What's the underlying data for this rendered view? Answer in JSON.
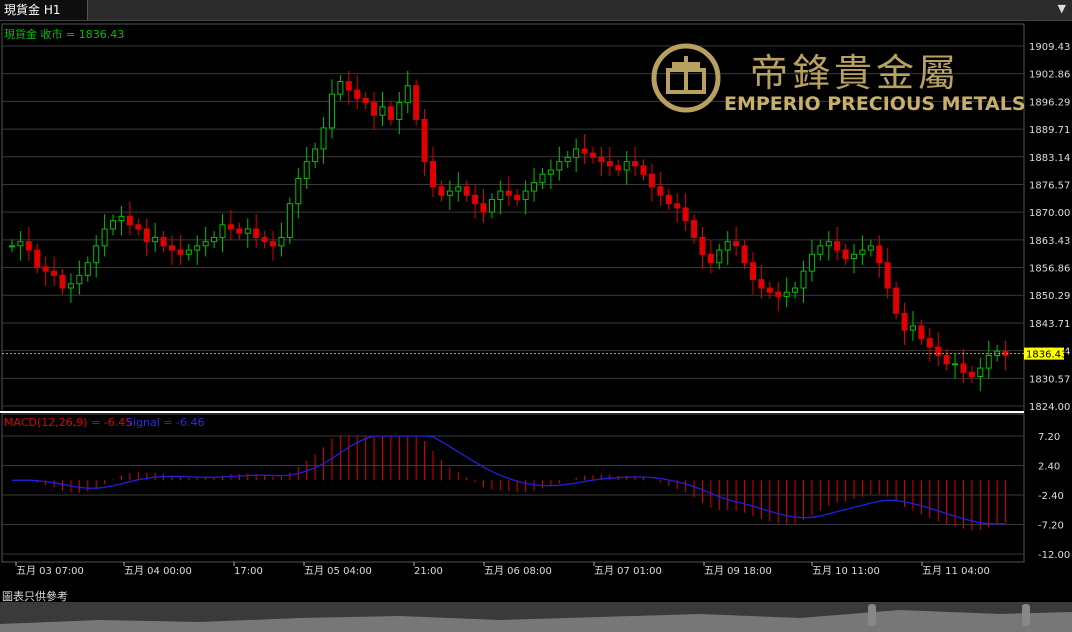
{
  "window": {
    "tab_label": "現貨金 H1"
  },
  "colors": {
    "up": "#00c000",
    "down": "#e00000",
    "grid": "#3a3a3a",
    "macd": "#e00000",
    "signal": "#2020e0",
    "price_tag": "#ffff00",
    "ohlc_label": "#00c000"
  },
  "chart_data": [
    {
      "type": "candlestick",
      "title": "現貨金 收市 = 1836.43",
      "last_price": "1836.43",
      "y_ticks": [
        "1909.43",
        "1902.86",
        "1896.29",
        "1889.71",
        "1883.14",
        "1876.57",
        "1870.00",
        "1863.43",
        "1856.86",
        "1850.29",
        "1843.71",
        "1837.14",
        "1830.57",
        "1824.00"
      ],
      "ylim": [
        1824.0,
        1909.43
      ],
      "close_sample": [
        1862,
        1863,
        1861,
        1857,
        1856,
        1855,
        1852,
        1853,
        1855,
        1858,
        1862,
        1866,
        1868,
        1869,
        1867,
        1866,
        1863,
        1864,
        1862,
        1861,
        1860,
        1861,
        1862,
        1863,
        1864,
        1867,
        1866,
        1865,
        1866,
        1864,
        1863,
        1862,
        1864,
        1872,
        1878,
        1882,
        1885,
        1890,
        1898,
        1901,
        1899,
        1897,
        1896,
        1893,
        1895,
        1892,
        1896,
        1900,
        1892,
        1882,
        1876,
        1874,
        1875,
        1876,
        1874,
        1872,
        1870,
        1873,
        1875,
        1874,
        1873,
        1875,
        1877,
        1879,
        1880,
        1882,
        1883,
        1885,
        1884,
        1883,
        1882,
        1881,
        1880,
        1882,
        1881,
        1879,
        1876,
        1874,
        1872,
        1871,
        1868,
        1864,
        1860,
        1858,
        1861,
        1863,
        1862,
        1858,
        1854,
        1852,
        1851,
        1850,
        1851,
        1852,
        1856,
        1860,
        1862,
        1863,
        1861,
        1859,
        1860,
        1861,
        1862,
        1858,
        1852,
        1846,
        1842,
        1843,
        1840,
        1838,
        1836,
        1834,
        1834,
        1832,
        1831,
        1833,
        1836,
        1837,
        1836
      ]
    },
    {
      "type": "macd",
      "label": "MACD(12,26,9) = -6.45",
      "signal_label": "Signal = -6.46",
      "y_ticks": [
        "7.20",
        "2.40",
        "-2.40",
        "-7.20",
        "-12.00"
      ],
      "ylim": [
        -12.0,
        7.2
      ],
      "x_ticks": [
        "五月 03 07:00",
        "五月 04 00:00",
        "17:00",
        "五月 05 04:00",
        "21:00",
        "五月 06 08:00",
        "五月 07 01:00",
        "五月 09 18:00",
        "五月 10 11:00",
        "五月 11 04:00"
      ]
    }
  ],
  "logo": {
    "chinese": "帝鋒貴金屬",
    "english": "EMPERIO PRECIOUS METALS"
  },
  "footer": {
    "note": "圖表只供參考"
  }
}
